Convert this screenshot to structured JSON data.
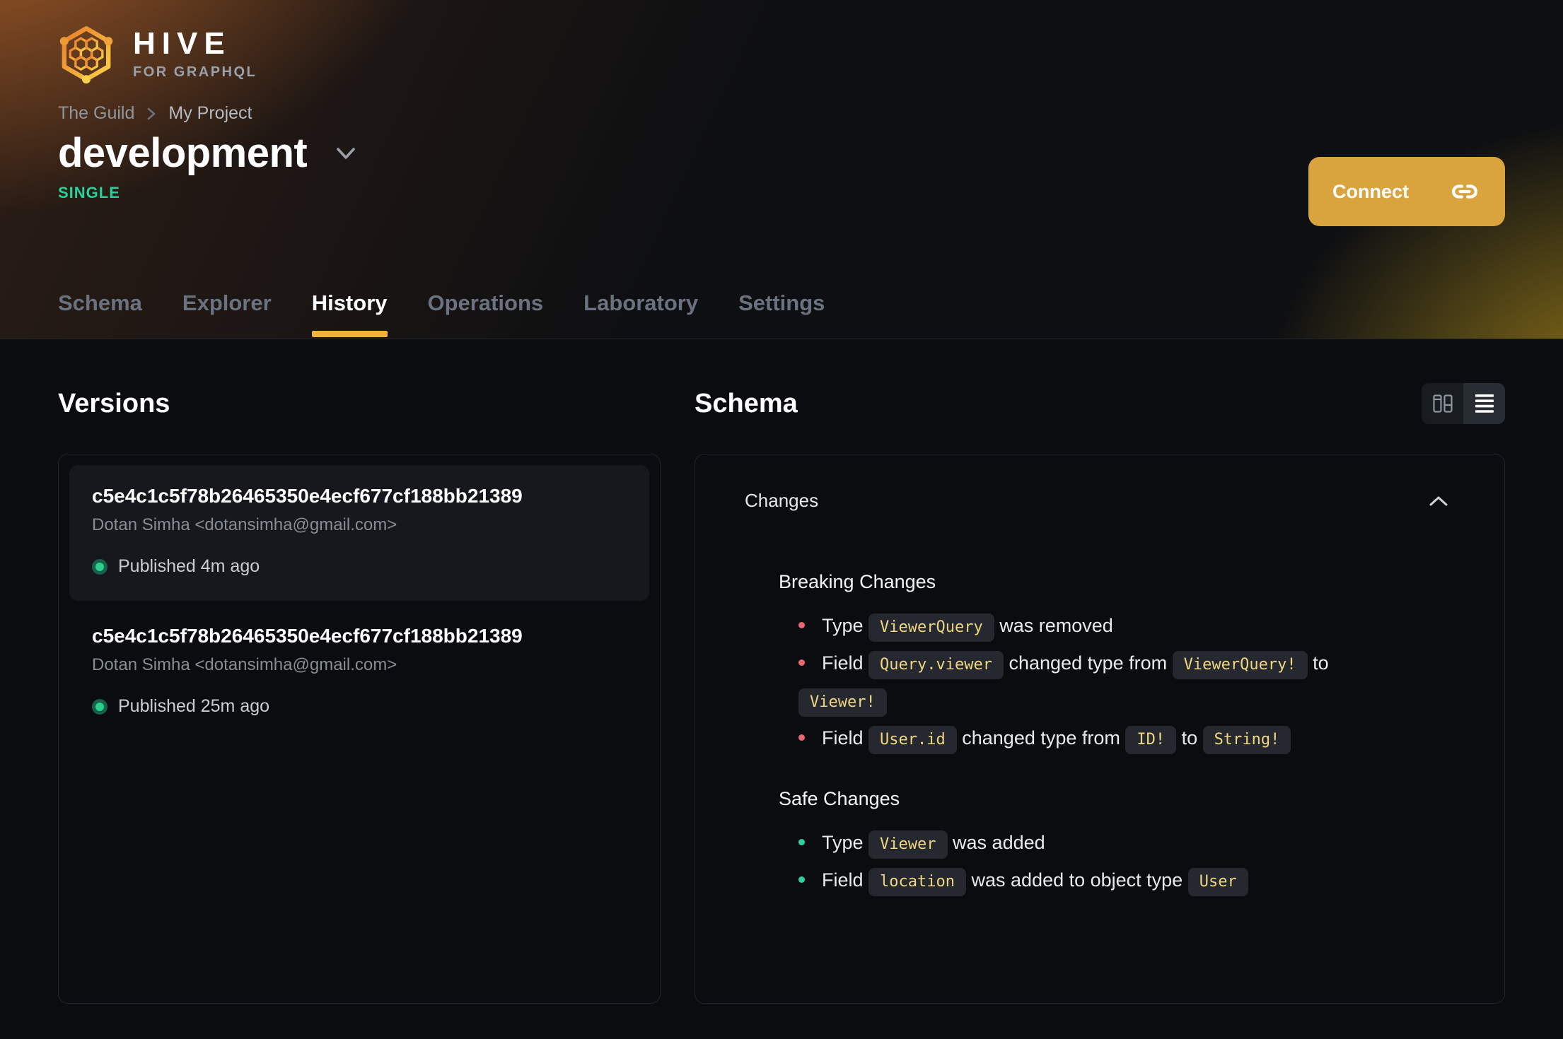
{
  "colors": {
    "accent": "#f1b23d",
    "connect_button": "#d9a43e",
    "badge_green": "#25d29a",
    "breaking_bullet": "#ee6672",
    "safe_bullet": "#2bd39b",
    "chip_text": "#eed581",
    "published_dot": "#2bd08d"
  },
  "icons": {
    "logo": "hive-hexagon-logo",
    "breadcrumb_separator": "chevron-right-icon",
    "target_caret": "chevron-down-icon",
    "connect": "link-icon",
    "view_split": "columns-icon",
    "view_list": "list-icon",
    "changes_collapse": "chevron-up-icon",
    "published_status": "green-dot-icon"
  },
  "brand": {
    "name": "HIVE",
    "tagline": "FOR GRAPHQL"
  },
  "breadcrumb": {
    "org": "The Guild",
    "project": "My Project"
  },
  "target": {
    "name": "development",
    "badge": "SINGLE"
  },
  "connect": {
    "label": "Connect"
  },
  "tabs": [
    {
      "label": "Schema",
      "active": false
    },
    {
      "label": "Explorer",
      "active": false
    },
    {
      "label": "History",
      "active": true
    },
    {
      "label": "Operations",
      "active": false
    },
    {
      "label": "Laboratory",
      "active": false
    },
    {
      "label": "Settings",
      "active": false
    }
  ],
  "versions": {
    "title": "Versions",
    "items": [
      {
        "hash": "c5e4c1c5f78b26465350e4ecf677cf188bb21389",
        "author": "Dotan Simha <dotansimha@gmail.com>",
        "status": "Published 4m ago",
        "selected": true
      },
      {
        "hash": "c5e4c1c5f78b26465350e4ecf677cf188bb21389",
        "author": "Dotan Simha <dotansimha@gmail.com>",
        "status": "Published 25m ago",
        "selected": false
      }
    ]
  },
  "schema": {
    "title": "Schema",
    "changes_label": "Changes",
    "sections": [
      {
        "title": "Breaking Changes",
        "severity": "breaking",
        "bullet_color": "#ee6672",
        "items": [
          {
            "segments": [
              {
                "text": "Type "
              },
              {
                "code": "ViewerQuery"
              },
              {
                "text": " was removed"
              }
            ]
          },
          {
            "segments": [
              {
                "text": "Field "
              },
              {
                "code": "Query.viewer"
              },
              {
                "text": " changed type from "
              },
              {
                "code": "ViewerQuery!"
              },
              {
                "text": " to "
              },
              {
                "code": "Viewer!"
              }
            ]
          },
          {
            "segments": [
              {
                "text": "Field "
              },
              {
                "code": "User.id"
              },
              {
                "text": " changed type from "
              },
              {
                "code": "ID!"
              },
              {
                "text": " to "
              },
              {
                "code": "String!"
              }
            ]
          }
        ]
      },
      {
        "title": "Safe Changes",
        "severity": "safe",
        "bullet_color": "#2bd39b",
        "items": [
          {
            "segments": [
              {
                "text": "Type "
              },
              {
                "code": "Viewer"
              },
              {
                "text": " was added"
              }
            ]
          },
          {
            "segments": [
              {
                "text": "Field "
              },
              {
                "code": "location"
              },
              {
                "text": " was added to object type "
              },
              {
                "code": "User"
              }
            ]
          }
        ]
      }
    ]
  }
}
